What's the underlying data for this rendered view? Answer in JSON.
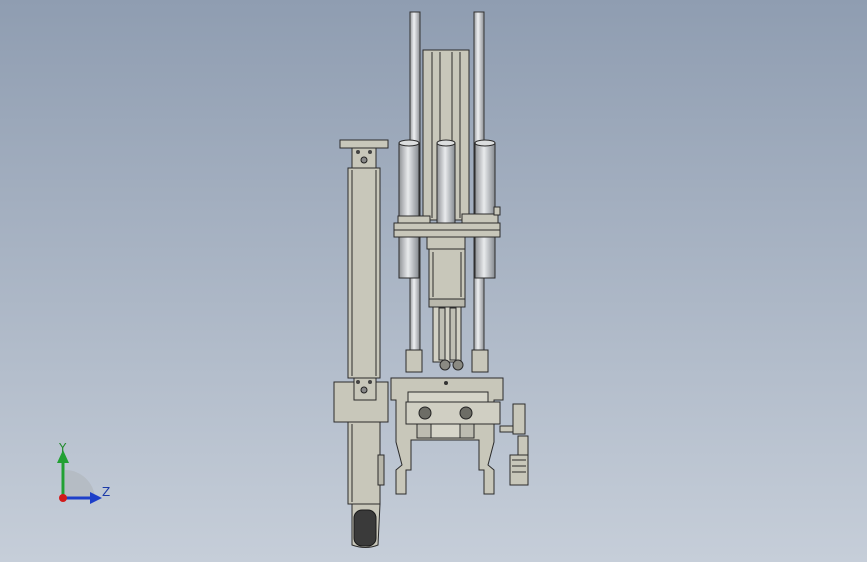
{
  "viewport": {
    "background_top": "#8f9db1",
    "background_bottom": "#c6ced9",
    "model_fill": "#c9c8bb",
    "model_stroke": "#2b2b2b",
    "rod_fill": "#cfd1d4"
  },
  "triad": {
    "y_label": "Y",
    "z_label": "Z",
    "y_color": "#22a033",
    "z_color": "#1d3fc9",
    "x_color": "#d11a1a"
  }
}
